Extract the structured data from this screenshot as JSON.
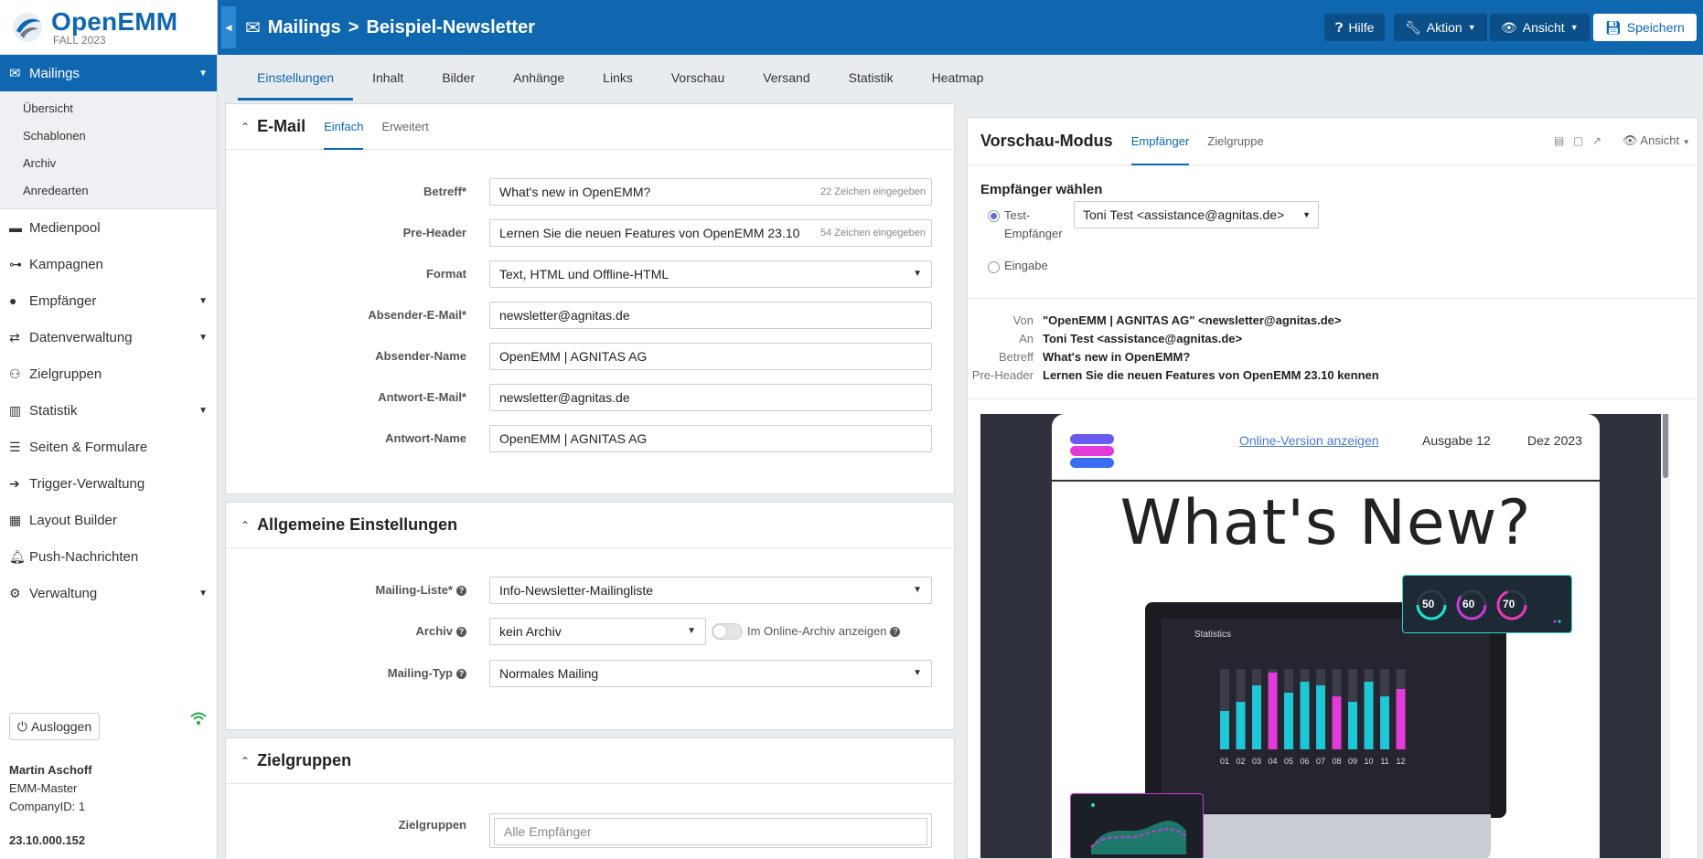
{
  "app": {
    "brand": "OpenEMM",
    "release": "FALL 2023"
  },
  "sidebar": {
    "active": {
      "label": "Mailings",
      "icon": "envelope-icon"
    },
    "subitems": [
      "Übersicht",
      "Schablonen",
      "Archiv",
      "Anredearten"
    ],
    "items": [
      {
        "label": "Medienpool",
        "icon": "folder-icon",
        "has_caret": false
      },
      {
        "label": "Kampagnen",
        "icon": "sitemap-icon",
        "has_caret": false
      },
      {
        "label": "Empfänger",
        "icon": "user-icon",
        "has_caret": true
      },
      {
        "label": "Datenverwaltung",
        "icon": "exchange-icon",
        "has_caret": true
      },
      {
        "label": "Zielgruppen",
        "icon": "users-icon",
        "has_caret": false
      },
      {
        "label": "Statistik",
        "icon": "bar-chart-icon",
        "has_caret": true
      },
      {
        "label": "Seiten & Formulare",
        "icon": "list-icon",
        "has_caret": false
      },
      {
        "label": "Trigger-Verwaltung",
        "icon": "arrow-circle-icon",
        "has_caret": false
      },
      {
        "label": "Layout Builder",
        "icon": "grid-icon",
        "has_caret": false
      },
      {
        "label": "Push-Nachrichten",
        "icon": "bell-icon",
        "has_caret": false
      },
      {
        "label": "Verwaltung",
        "icon": "gear-icon",
        "has_caret": true
      }
    ],
    "logout_label": "Ausloggen",
    "user_name": "Martin Aschoff",
    "user_role": "EMM-Master",
    "company": "CompanyID: 1",
    "version": "23.10.000.152"
  },
  "header": {
    "section": "Mailings",
    "separator": ">",
    "page": "Beispiel-Newsletter",
    "help_label": "Hilfe",
    "action_label": "Aktion",
    "view_label": "Ansicht",
    "save_label": "Speichern"
  },
  "tabs": [
    "Einstellungen",
    "Inhalt",
    "Bilder",
    "Anhänge",
    "Links",
    "Vorschau",
    "Versand",
    "Statistik",
    "Heatmap"
  ],
  "email_panel": {
    "title": "E-Mail",
    "tab_simple": "Einfach",
    "tab_advanced": "Erweitert",
    "fields": {
      "subject_label": "Betreff*",
      "subject_value": "What's new in OpenEMM?",
      "subject_hint": "22 Zeichen eingegeben",
      "preheader_label": "Pre-Header",
      "preheader_value": "Lernen Sie die neuen Features von OpenEMM 23.10",
      "preheader_hint": "54 Zeichen eingegeben",
      "format_label": "Format",
      "format_value": "Text, HTML und Offline-HTML",
      "sender_email_label": "Absender-E-Mail*",
      "sender_email_value": "newsletter@agnitas.de",
      "sender_name_label": "Absender-Name",
      "sender_name_value": "OpenEMM | AGNITAS AG",
      "reply_email_label": "Antwort-E-Mail*",
      "reply_email_value": "newsletter@agnitas.de",
      "reply_name_label": "Antwort-Name",
      "reply_name_value": "OpenEMM | AGNITAS AG"
    }
  },
  "general_panel": {
    "title": "Allgemeine Einstellungen",
    "mailing_list_label": "Mailing-Liste*",
    "mailing_list_value": "Info-Newsletter-Mailingliste",
    "archive_label": "Archiv",
    "archive_value": "kein Archiv",
    "online_archive_label": "Im Online-Archiv anzeigen",
    "online_archive_enabled": false,
    "mailing_type_label": "Mailing-Typ",
    "mailing_type_value": "Normales Mailing"
  },
  "target_panel": {
    "title": "Zielgruppen",
    "label": "Zielgruppen",
    "placeholder": "Alle Empfänger"
  },
  "preview": {
    "title": "Vorschau-Modus",
    "tab_recipient": "Empfänger",
    "tab_target": "Zielgruppe",
    "view_label": "Ansicht",
    "choose_title": "Empfänger wählen",
    "radio_test_line1": "Test-",
    "radio_test_line2": "Empfänger",
    "radio_input": "Eingabe",
    "selected_recipient": "Toni Test <assistance@agnitas.de>",
    "from_label": "Von",
    "from_value": "\"OpenEMM | AGNITAS AG\" <newsletter@agnitas.de>",
    "to_label": "An",
    "to_value": "Toni Test <assistance@agnitas.de>",
    "subject_label": "Betreff",
    "subject_value": "What's new in OpenEMM?",
    "preheader_label": "Pre-Header",
    "preheader_value": "Lernen Sie die neuen Features von OpenEMM 23.10 kennen",
    "newsletter": {
      "online_link": "Online-Version anzeigen",
      "issue": "Ausgabe 12",
      "date": "Dez 2023",
      "headline": "What's New?",
      "stats_title": "Statistics",
      "gauge_values": [
        "50",
        "60",
        "70"
      ],
      "bar_labels": [
        "01",
        "02",
        "03",
        "04",
        "05",
        "06",
        "07",
        "08",
        "09",
        "10",
        "11",
        "12"
      ]
    }
  },
  "colors": {
    "primary": "#0f67b0",
    "online_green": "#2aa84a"
  }
}
